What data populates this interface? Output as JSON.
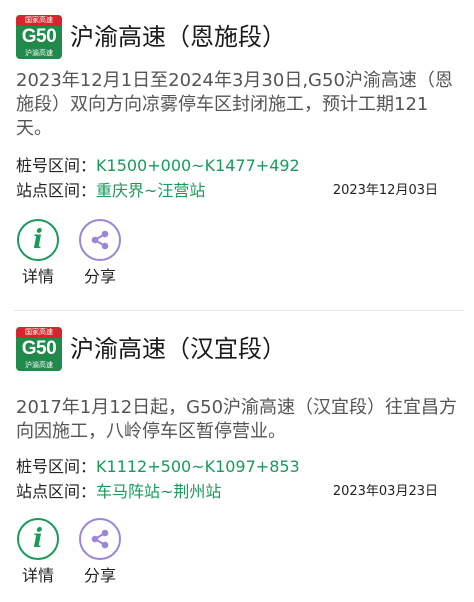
{
  "items": [
    {
      "shield": {
        "top": "国家高速",
        "code": "G50",
        "name": "沪渝高速"
      },
      "title": "沪渝高速（恩施段）",
      "description": "2023年12月1日至2024年3月30日,G50沪渝高速（恩施段）双向方向凉雾停车区封闭施工，预计工期121天。",
      "stake_label": "桩号区间：",
      "stake_value": "K1500+000~K1477+492",
      "station_label": "站点区间：",
      "station_value": "重庆界~汪营站",
      "date": "2023年12月03日",
      "detail_label": "详情",
      "share_label": "分享"
    },
    {
      "shield": {
        "top": "国家高速",
        "code": "G50",
        "name": "沪渝高速"
      },
      "title": "沪渝高速（汉宜段）",
      "description": "2017年1月12日起，G50沪渝高速（汉宜段）往宜昌方向因施工，八岭停车区暂停营业。",
      "stake_label": "桩号区间：",
      "stake_value": "K1112+500~K1097+853",
      "station_label": "站点区间：",
      "station_value": "车马阵站~荆州站",
      "date": "2023年03月23日",
      "detail_label": "详情",
      "share_label": "分享"
    }
  ],
  "colors": {
    "accent_green": "#1a9a5c",
    "share_purple": "#9b86d8",
    "shield_green": "#1f8a4c",
    "shield_red": "#d7262b"
  },
  "icons": {
    "detail": "info-icon",
    "share": "share-icon"
  }
}
